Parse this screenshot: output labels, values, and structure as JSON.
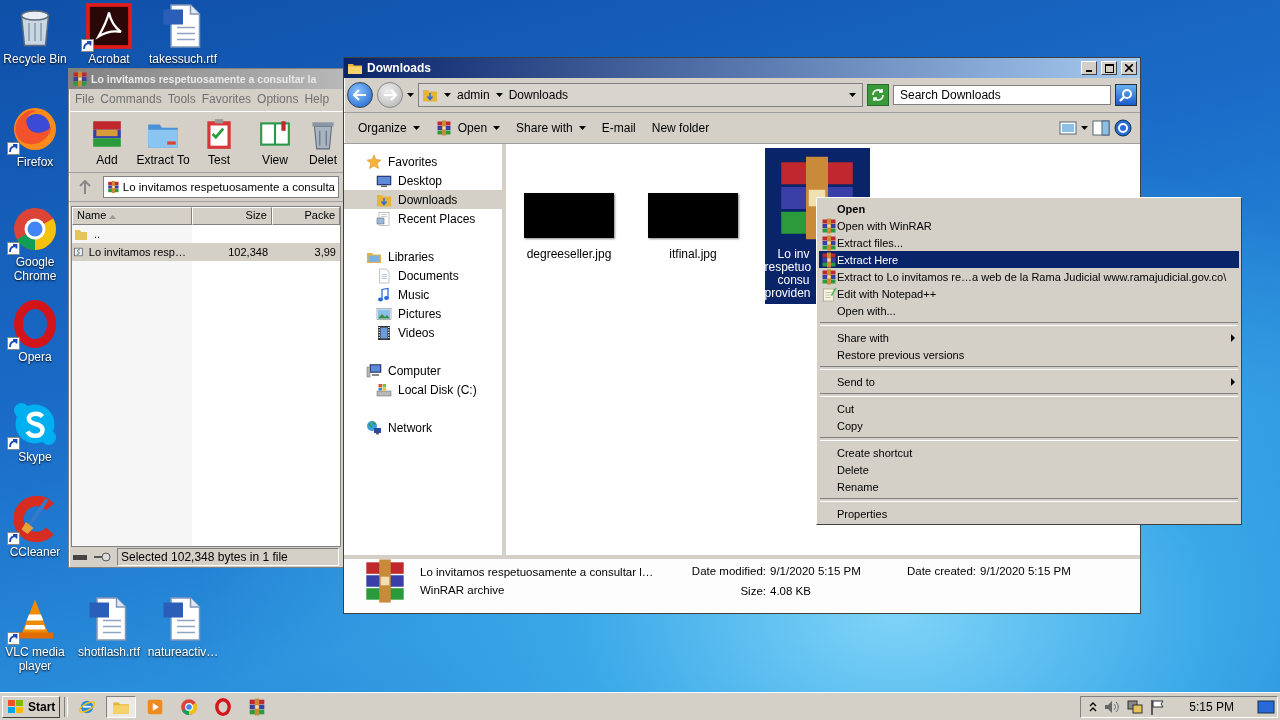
{
  "desktop": {
    "icons": [
      {
        "label": "Recycle Bin",
        "kind": "recycle",
        "shortcut": false
      },
      {
        "label": "Acrobat",
        "kind": "acrobat",
        "shortcut": true
      },
      {
        "label": "takessuch.rtf",
        "kind": "word",
        "shortcut": false
      },
      {
        "label": "Firefox",
        "kind": "firefox",
        "shortcut": true
      },
      {
        "label": "Google Chrome",
        "kind": "chrome",
        "shortcut": true
      },
      {
        "label": "Opera",
        "kind": "opera",
        "shortcut": true
      },
      {
        "label": "Skype",
        "kind": "skype",
        "shortcut": true
      },
      {
        "label": "CCleaner",
        "kind": "ccleaner",
        "shortcut": true
      },
      {
        "label": "VLC media player",
        "kind": "vlc",
        "shortcut": true
      },
      {
        "label": "shotflash.rtf",
        "kind": "word",
        "shortcut": false
      },
      {
        "label": "natureactiv…",
        "kind": "word",
        "shortcut": false
      }
    ]
  },
  "winrar": {
    "title": "Lo invitamos respetuosamente a consultar la",
    "menu": [
      "File",
      "Commands",
      "Tools",
      "Favorites",
      "Options",
      "Help"
    ],
    "tools": [
      {
        "label": "Add",
        "kind": "add"
      },
      {
        "label": "Extract To",
        "kind": "extract"
      },
      {
        "label": "Test",
        "kind": "test"
      },
      {
        "label": "View",
        "kind": "view"
      },
      {
        "label": "Delet",
        "kind": "delete"
      }
    ],
    "path": "Lo invitamos respetuosamente a consulta",
    "columns": [
      "Name",
      "Size",
      "Packe"
    ],
    "rows": [
      {
        "kind": "up",
        "selected": false,
        "cells": [
          ".."
        ]
      },
      {
        "kind": "file",
        "selected": true,
        "cells": [
          "Lo invitamos resp…",
          "102,348",
          "3,99"
        ]
      }
    ],
    "status": "Selected 102,348 bytes in 1 file"
  },
  "explorer": {
    "title": "Downloads",
    "breadcrumbs": [
      "admin",
      "Downloads"
    ],
    "search": {
      "placeholder": "Search Downloads"
    },
    "toolbar": [
      {
        "label": "Organize",
        "dropdown": true
      },
      {
        "label": "Open",
        "kind": "archive",
        "dropdown": true
      },
      {
        "label": "Share with",
        "dropdown": true
      },
      {
        "label": "E-mail",
        "dropdown": false
      },
      {
        "label": "New folder",
        "dropdown": false
      }
    ],
    "nav": [
      {
        "label": "Favorites",
        "kind": "star",
        "selected": false,
        "children": [
          {
            "label": "Desktop",
            "kind": "desktop",
            "selected": false
          },
          {
            "label": "Downloads",
            "kind": "downloads",
            "selected": true
          },
          {
            "label": "Recent Places",
            "kind": "recent",
            "selected": false
          }
        ]
      },
      {
        "label": "Libraries",
        "kind": "libraries",
        "selected": false,
        "children": [
          {
            "label": "Documents",
            "kind": "documents",
            "selected": false
          },
          {
            "label": "Music",
            "kind": "music",
            "selected": false
          },
          {
            "label": "Pictures",
            "kind": "pictures",
            "selected": false
          },
          {
            "label": "Videos",
            "kind": "videos",
            "selected": false
          }
        ]
      },
      {
        "label": "Computer",
        "kind": "computer",
        "selected": false,
        "children": [
          {
            "label": "Local Disk (C:)",
            "kind": "disk",
            "selected": false
          }
        ]
      },
      {
        "label": "Network",
        "kind": "network",
        "selected": false
      }
    ],
    "files": [
      {
        "kind": "image",
        "name_lines": [
          "degreeseller.jpg"
        ],
        "selected": false
      },
      {
        "kind": "image",
        "name_lines": [
          "itfinal.jpg"
        ],
        "selected": false
      },
      {
        "kind": "archive",
        "name_lines": [
          "Lo inv",
          "respetuo",
          "consu",
          "providen"
        ],
        "selected": true
      }
    ],
    "details": {
      "name": "Lo invitamos respetuosamente a consultar l…",
      "type": "WinRAR archive",
      "fields": [
        {
          "label": "Date modified:",
          "value": "9/1/2020 5:15 PM"
        },
        {
          "label": "Date created:",
          "value": "9/1/2020 5:15 PM"
        },
        {
          "label": "Size:",
          "value": "4.08 KB"
        }
      ]
    }
  },
  "context_menu": {
    "items": [
      {
        "kind": "item",
        "label": "Open",
        "default": true,
        "selected": false,
        "submenu": false
      },
      {
        "kind": "archive_item",
        "label": "Open with WinRAR",
        "default": false,
        "selected": false,
        "submenu": false
      },
      {
        "kind": "archive_item",
        "label": "Extract files...",
        "default": false,
        "selected": false,
        "submenu": false
      },
      {
        "kind": "archive_item",
        "label": "Extract Here",
        "default": false,
        "selected": true,
        "submenu": false
      },
      {
        "kind": "archive_item",
        "label": "Extract to Lo invitamos re…a web de la Rama Judicial www.ramajudicial.gov.co\\",
        "default": false,
        "selected": false,
        "submenu": false
      },
      {
        "kind": "editor_item",
        "label": "Edit with Notepad++",
        "default": false,
        "selected": false,
        "submenu": false
      },
      {
        "kind": "item",
        "label": "Open with...",
        "default": false,
        "selected": false,
        "submenu": false
      },
      {
        "kind": "separator"
      },
      {
        "kind": "item",
        "label": "Share with",
        "default": false,
        "selected": false,
        "submenu": true
      },
      {
        "kind": "item",
        "label": "Restore previous versions",
        "default": false,
        "selected": false,
        "submenu": false
      },
      {
        "kind": "separator"
      },
      {
        "kind": "item",
        "label": "Send to",
        "default": false,
        "selected": false,
        "submenu": true
      },
      {
        "kind": "separator"
      },
      {
        "kind": "item",
        "label": "Cut",
        "default": false,
        "selected": false,
        "submenu": false
      },
      {
        "kind": "item",
        "label": "Copy",
        "default": false,
        "selected": false,
        "submenu": false
      },
      {
        "kind": "separator"
      },
      {
        "kind": "item",
        "label": "Create shortcut",
        "default": false,
        "selected": false,
        "submenu": false
      },
      {
        "kind": "item",
        "label": "Delete",
        "default": false,
        "selected": false,
        "submenu": false
      },
      {
        "kind": "item",
        "label": "Rename",
        "default": false,
        "selected": false,
        "submenu": false
      },
      {
        "kind": "separator"
      },
      {
        "kind": "item",
        "label": "Properties",
        "default": false,
        "selected": false,
        "submenu": false
      }
    ]
  },
  "taskbar": {
    "start": "Start",
    "apps": [
      {
        "kind": "ie",
        "selected": false
      },
      {
        "kind": "explorer",
        "selected": true
      },
      {
        "kind": "media",
        "selected": false
      },
      {
        "kind": "chrome",
        "selected": false
      },
      {
        "kind": "opera",
        "selected": false
      },
      {
        "kind": "winrar",
        "selected": false
      }
    ],
    "clock": "5:15 PM"
  }
}
